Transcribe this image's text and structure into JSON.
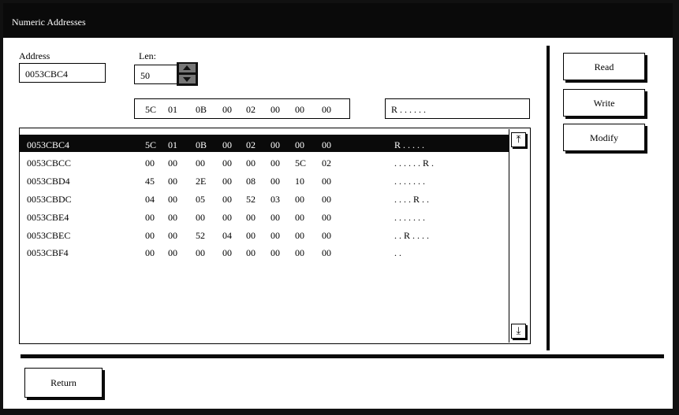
{
  "window": {
    "title": "Numeric Addresses"
  },
  "address": {
    "label": "Address",
    "value": "0053CBC4"
  },
  "len": {
    "label": "Len:",
    "value": "50"
  },
  "edit": {
    "hex": [
      "5C",
      "01",
      "0B",
      "00",
      "02",
      "00",
      "00",
      "00"
    ],
    "ascii": "R . . . . . ."
  },
  "rows": [
    {
      "addr": "0053CBC4",
      "hex": [
        "5C",
        "01",
        "0B",
        "00",
        "02",
        "00",
        "00",
        "00"
      ],
      "ascii": "R . . . . .",
      "selected": true
    },
    {
      "addr": "0053CBCC",
      "hex": [
        "00",
        "00",
        "00",
        "00",
        "00",
        "00",
        "5C",
        "02"
      ],
      "ascii": ". . . . . . R .",
      "selected": false
    },
    {
      "addr": "0053CBD4",
      "hex": [
        "45",
        "00",
        "2E",
        "00",
        "08",
        "00",
        "10",
        "00"
      ],
      "ascii": ". . . . . . .",
      "selected": false
    },
    {
      "addr": "0053CBDC",
      "hex": [
        "04",
        "00",
        "05",
        "00",
        "52",
        "03",
        "00",
        "00"
      ],
      "ascii": ". . . . R . .",
      "selected": false
    },
    {
      "addr": "0053CBE4",
      "hex": [
        "00",
        "00",
        "00",
        "00",
        "00",
        "00",
        "00",
        "00"
      ],
      "ascii": ". . . . . . .",
      "selected": false
    },
    {
      "addr": "0053CBEC",
      "hex": [
        "00",
        "00",
        "52",
        "04",
        "00",
        "00",
        "00",
        "00"
      ],
      "ascii": ". . R . . . .",
      "selected": false
    },
    {
      "addr": "0053CBF4",
      "hex": [
        "00",
        "00",
        "00",
        "00",
        "00",
        "00",
        "00",
        "00"
      ],
      "ascii": ". .",
      "selected": false
    }
  ],
  "buttons": {
    "read": "Read",
    "write": "Write",
    "modify": "Modify",
    "return": "Return"
  },
  "scroll": {
    "up_glyph": "⤒",
    "down_glyph": "⤓"
  },
  "icons": {
    "spin_up": "caret-up-icon",
    "spin_down": "caret-down-icon",
    "scroll_up": "scroll-up-arrow-icon",
    "scroll_down": "scroll-down-arrow-icon"
  },
  "colors": {
    "frame": "#111111",
    "selection": "#0a0a0a",
    "spin": "#777777"
  }
}
